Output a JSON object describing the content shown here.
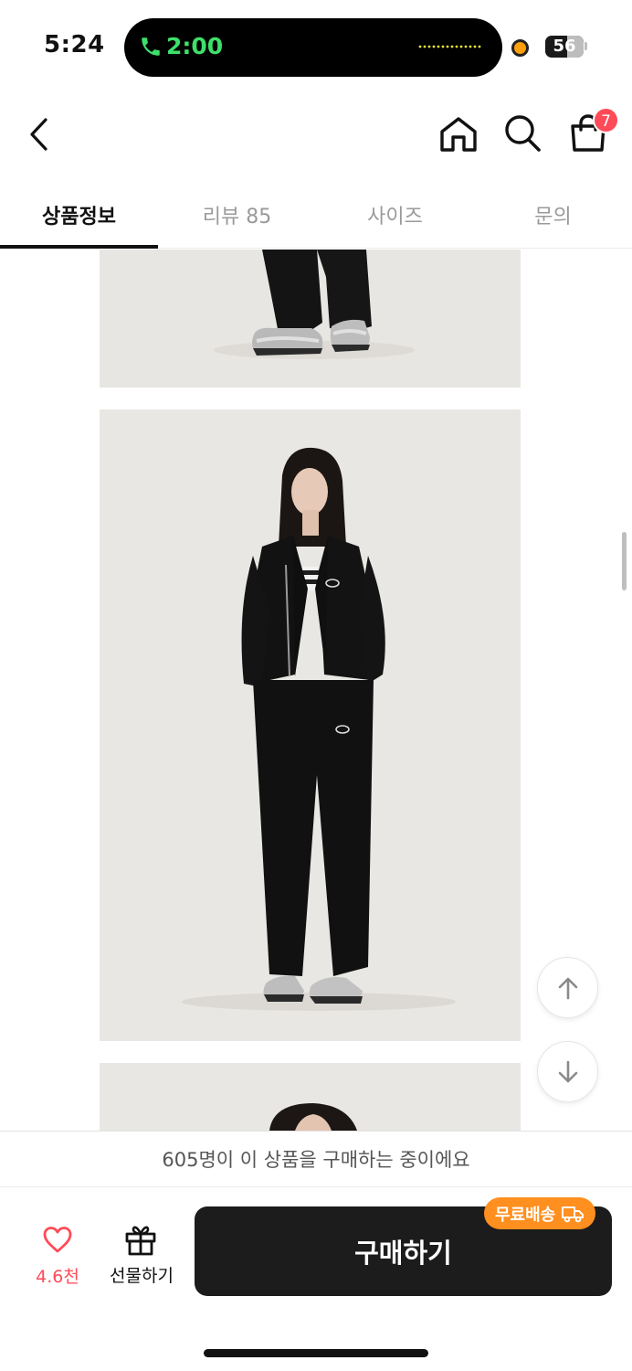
{
  "status_bar": {
    "time": "5:24",
    "call_duration": "2:00",
    "battery_level": "56"
  },
  "header": {
    "cart_count": "7"
  },
  "tabs": [
    {
      "label": "상품정보",
      "active": true
    },
    {
      "label": "리뷰 85",
      "active": false
    },
    {
      "label": "사이즈",
      "active": false
    },
    {
      "label": "문의",
      "active": false
    }
  ],
  "notice": {
    "text": "605명이 이 상품을 구매하는 중이에요"
  },
  "bottom_bar": {
    "like_count": "4.6천",
    "gift_label": "선물하기",
    "buy_label": "구매하기",
    "free_shipping_label": "무료배송"
  },
  "colors": {
    "accent_red": "#ff4a57",
    "shipping_orange": "#ff8f1f",
    "buy_button": "#1c1c1c",
    "call_green": "#3ee06a"
  }
}
